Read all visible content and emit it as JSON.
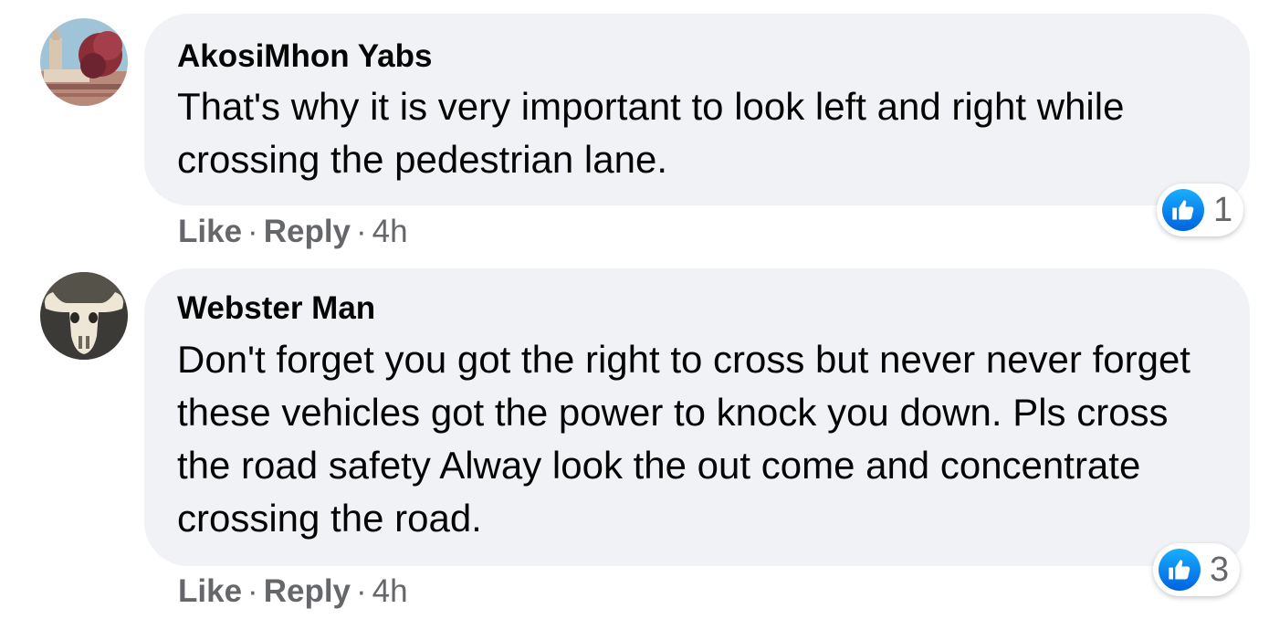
{
  "colors": {
    "bubble": "#f0f2f5",
    "meta_text": "#65676b",
    "like_blue": "#1877f2"
  },
  "comments": [
    {
      "author": "AkosiMhon Yabs",
      "text": "That's why it is very important to look left and right while crossing the pedestrian lane.",
      "like_label": "Like",
      "reply_label": "Reply",
      "separator": "·",
      "time": "4h",
      "reaction_icon": "thumbs-up-icon",
      "reaction_count": "1"
    },
    {
      "author": "Webster Man",
      "text": "Don't forget you got the right to cross but never never forget these vehicles got the power to knock you down. Pls cross the road safety Alway look the out come and concentrate crossing the road.",
      "like_label": "Like",
      "reply_label": "Reply",
      "separator": "·",
      "time": "4h",
      "reaction_icon": "thumbs-up-icon",
      "reaction_count": "3"
    }
  ]
}
